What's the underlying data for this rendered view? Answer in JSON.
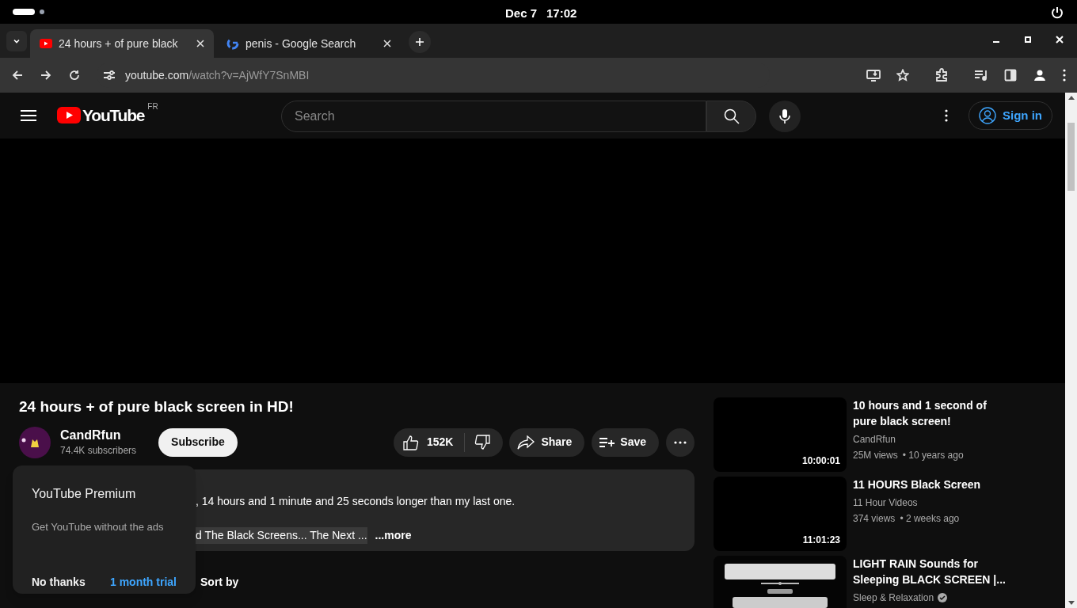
{
  "system_bar": {
    "date": "Dec 7",
    "time": "17:02"
  },
  "tabs": [
    {
      "title": "24 hours + of pure black",
      "kind": "video",
      "selected": true
    },
    {
      "title": "penis - Google Search",
      "kind": "search",
      "selected": false
    }
  ],
  "address": {
    "host": "youtube.com",
    "path": "/watch?v=AjWfY7SnMBI"
  },
  "header": {
    "logo_text": "YouTube",
    "region": "FR",
    "search_placeholder": "Search",
    "sign_in": "Sign in"
  },
  "video": {
    "title": "24 hours + of pure black screen in HD!",
    "channel": "CandRfun",
    "subscribers": "74.4K subscribers",
    "subscribe": "Subscribe",
    "likes": "152K",
    "share": "Share",
    "save": "Save"
  },
  "description": {
    "line_1": ", 14 hours and 1 minute and 25 seconds longer than my last one.",
    "line_2": "d The Black Screens... The Next ...",
    "more": "...more"
  },
  "comments": {
    "sort": "Sort by"
  },
  "popup": {
    "title": "YouTube Premium",
    "body": "Get YouTube without the ads",
    "dismiss": "No thanks",
    "accept": "1 month trial"
  },
  "recommendations": [
    {
      "kind": "plain",
      "duration": "10:00:01",
      "title": "10 hours and 1 second of pure black screen!",
      "channel": "CandRfun",
      "verified": false,
      "views": "25M views",
      "age": "• 10 years ago"
    },
    {
      "kind": "plain",
      "duration": "11:01:23",
      "title": "11 HOURS Black Screen",
      "channel": "11 Hour Videos",
      "verified": false,
      "views": "374 views",
      "age": "• 2 weeks ago"
    },
    {
      "kind": "picture",
      "title": "LIGHT RAIN Sounds for Sleeping BLACK SCREEN |...",
      "channel": "Sleep & Relaxation",
      "verified": true
    }
  ]
}
